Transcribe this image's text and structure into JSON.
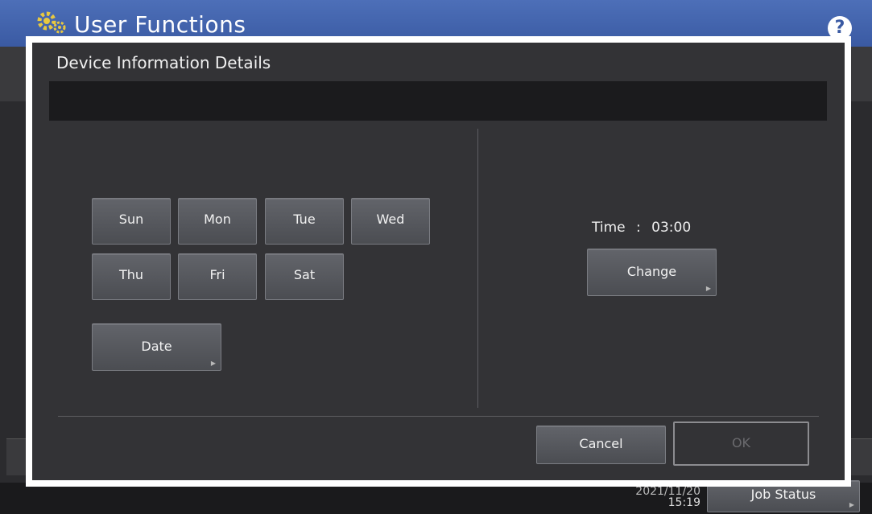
{
  "app": {
    "title": "User Functions",
    "help_icon": "question-mark-icon",
    "help_text": "?"
  },
  "dialog": {
    "title": "Device Information Details",
    "days": [
      "Sun",
      "Mon",
      "Tue",
      "Wed",
      "Thu",
      "Fri",
      "Sat"
    ],
    "date_label": "Date",
    "time_label": "Time",
    "time_separator": ":",
    "time_value": "03:00",
    "change_label": "Change",
    "cancel_label": "Cancel",
    "ok_label": "OK"
  },
  "footer": {
    "date": "2021/11/20",
    "time": "15:19",
    "job_status_label": "Job Status"
  },
  "colors": {
    "header_blue": "#3a5aa3",
    "dialog_bg": "#333336",
    "button_bg": "#56585d"
  }
}
